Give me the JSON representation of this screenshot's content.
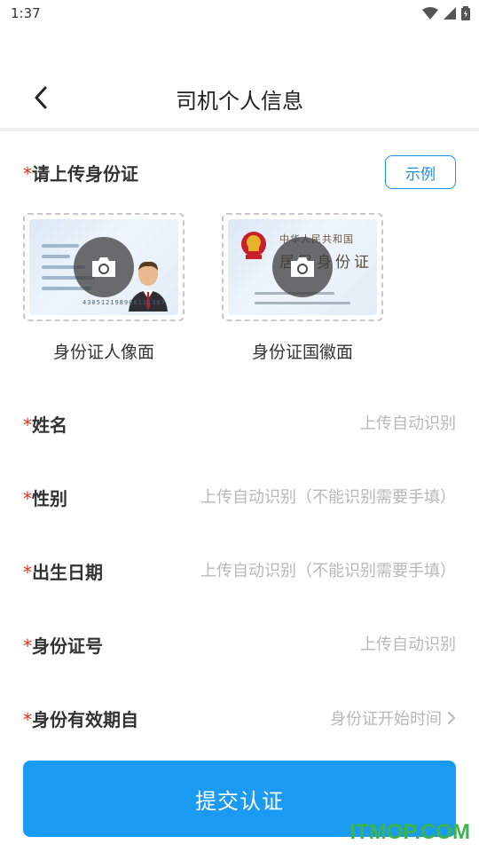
{
  "status_bar": {
    "time": "1:37"
  },
  "nav": {
    "title": "司机个人信息",
    "back_icon": "chevron-left-icon"
  },
  "upload": {
    "required_mark": "*",
    "title": "请上传身份证",
    "example_button": "示例",
    "front": {
      "label": "身份证人像面",
      "card_number": "430512198908131367"
    },
    "back": {
      "label": "身份证国徽面",
      "title_line1": "中华人民共和国",
      "title_line2": "居民身份证"
    },
    "camera_icon": "camera-icon"
  },
  "form": {
    "required_mark": "*",
    "name": {
      "label": "姓名",
      "placeholder": "上传自动识别"
    },
    "gender": {
      "label": "性别",
      "placeholder": "上传自动识别（不能识别需要手填）"
    },
    "birthdate": {
      "label": "出生日期",
      "placeholder": "上传自动识别（不能识别需要手填）"
    },
    "id_number": {
      "label": "身份证号",
      "placeholder": "上传自动识别"
    },
    "valid_from": {
      "label": "身份有效期自",
      "placeholder": "身份证开始时间"
    }
  },
  "submit_button": "提交认证",
  "watermark": "ITMOP.COM",
  "colors": {
    "accent": "#1a9af2",
    "required": "#e0301e",
    "watermark": "#3bb54a"
  }
}
